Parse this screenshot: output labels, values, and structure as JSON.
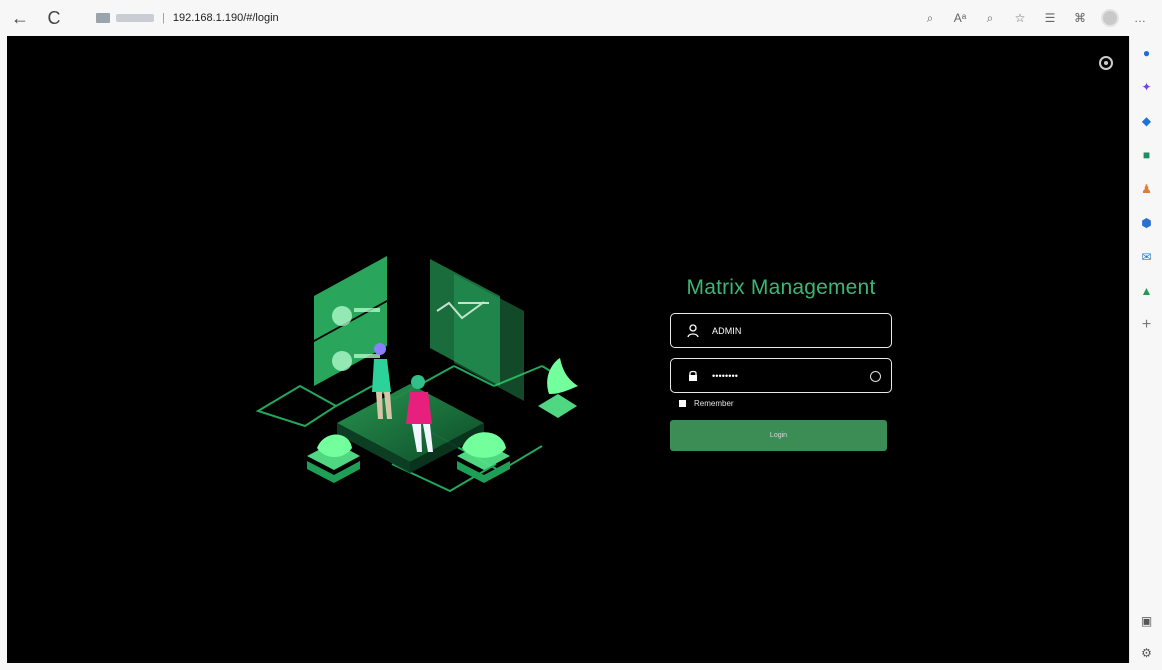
{
  "browser": {
    "url": "192.168.1.190/#/login",
    "nav": {
      "back": "←",
      "refresh": "C"
    }
  },
  "page": {
    "title": "Matrix Management",
    "username": "ADMIN",
    "password_mask": "••••••••",
    "remember_label": "Remember",
    "login_label": "Login"
  },
  "icons": {
    "search": "search-icon",
    "read_aloud": "read-aloud-icon",
    "zoom": "zoom-icon",
    "favorite": "favorite-icon",
    "collections": "collections-icon",
    "extensions": "extensions-icon",
    "profile": "avatar-icon",
    "more": "more-icon",
    "user": "user-icon",
    "lock": "lock-icon",
    "eye": "eye-icon",
    "settings": "settings-icon"
  },
  "colors": {
    "accent": "#3eb574",
    "button": "#3c8c55",
    "bg": "#000000"
  }
}
